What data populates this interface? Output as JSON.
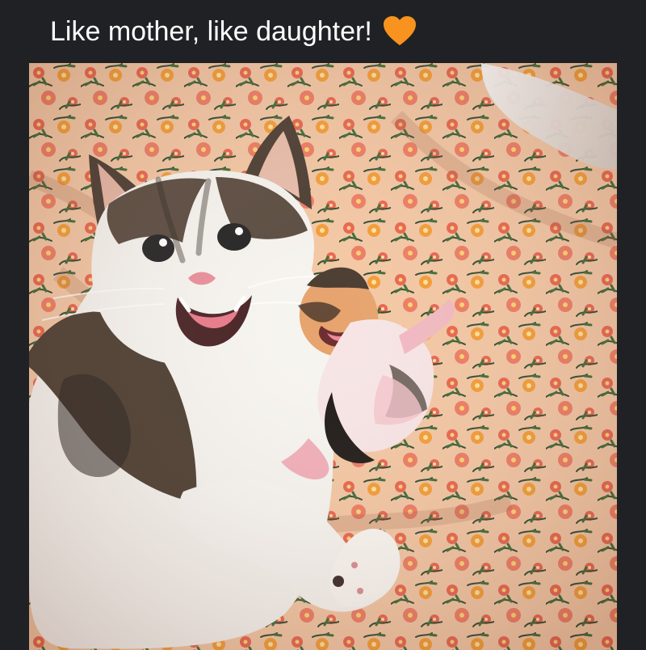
{
  "post": {
    "caption": "Like mother, like daughter!",
    "emoji": "orange-heart-icon"
  },
  "colors": {
    "background": "#202124",
    "caption_text": "#ffffff",
    "heart": "#f7931e",
    "fabric_base": "#f3c7a3",
    "flower_coral": "#e85f4d",
    "flower_orange": "#f59a2f",
    "cat_white": "#f6f4ef",
    "cat_tabby": "#4b3d30"
  }
}
